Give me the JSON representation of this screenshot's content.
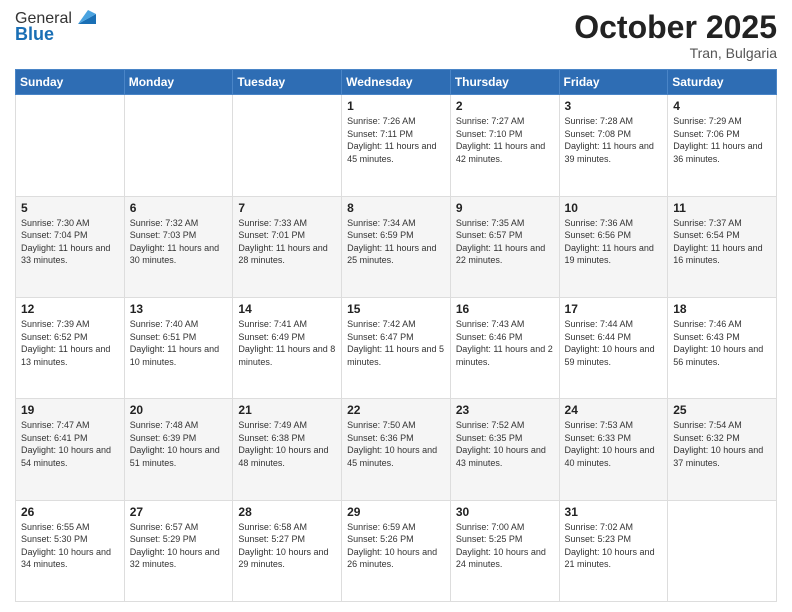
{
  "header": {
    "logo_general": "General",
    "logo_blue": "Blue",
    "month": "October 2025",
    "location": "Tran, Bulgaria"
  },
  "days_of_week": [
    "Sunday",
    "Monday",
    "Tuesday",
    "Wednesday",
    "Thursday",
    "Friday",
    "Saturday"
  ],
  "weeks": [
    [
      {
        "day": "",
        "info": ""
      },
      {
        "day": "",
        "info": ""
      },
      {
        "day": "",
        "info": ""
      },
      {
        "day": "1",
        "info": "Sunrise: 7:26 AM\nSunset: 7:11 PM\nDaylight: 11 hours and 45 minutes."
      },
      {
        "day": "2",
        "info": "Sunrise: 7:27 AM\nSunset: 7:10 PM\nDaylight: 11 hours and 42 minutes."
      },
      {
        "day": "3",
        "info": "Sunrise: 7:28 AM\nSunset: 7:08 PM\nDaylight: 11 hours and 39 minutes."
      },
      {
        "day": "4",
        "info": "Sunrise: 7:29 AM\nSunset: 7:06 PM\nDaylight: 11 hours and 36 minutes."
      }
    ],
    [
      {
        "day": "5",
        "info": "Sunrise: 7:30 AM\nSunset: 7:04 PM\nDaylight: 11 hours and 33 minutes."
      },
      {
        "day": "6",
        "info": "Sunrise: 7:32 AM\nSunset: 7:03 PM\nDaylight: 11 hours and 30 minutes."
      },
      {
        "day": "7",
        "info": "Sunrise: 7:33 AM\nSunset: 7:01 PM\nDaylight: 11 hours and 28 minutes."
      },
      {
        "day": "8",
        "info": "Sunrise: 7:34 AM\nSunset: 6:59 PM\nDaylight: 11 hours and 25 minutes."
      },
      {
        "day": "9",
        "info": "Sunrise: 7:35 AM\nSunset: 6:57 PM\nDaylight: 11 hours and 22 minutes."
      },
      {
        "day": "10",
        "info": "Sunrise: 7:36 AM\nSunset: 6:56 PM\nDaylight: 11 hours and 19 minutes."
      },
      {
        "day": "11",
        "info": "Sunrise: 7:37 AM\nSunset: 6:54 PM\nDaylight: 11 hours and 16 minutes."
      }
    ],
    [
      {
        "day": "12",
        "info": "Sunrise: 7:39 AM\nSunset: 6:52 PM\nDaylight: 11 hours and 13 minutes."
      },
      {
        "day": "13",
        "info": "Sunrise: 7:40 AM\nSunset: 6:51 PM\nDaylight: 11 hours and 10 minutes."
      },
      {
        "day": "14",
        "info": "Sunrise: 7:41 AM\nSunset: 6:49 PM\nDaylight: 11 hours and 8 minutes."
      },
      {
        "day": "15",
        "info": "Sunrise: 7:42 AM\nSunset: 6:47 PM\nDaylight: 11 hours and 5 minutes."
      },
      {
        "day": "16",
        "info": "Sunrise: 7:43 AM\nSunset: 6:46 PM\nDaylight: 11 hours and 2 minutes."
      },
      {
        "day": "17",
        "info": "Sunrise: 7:44 AM\nSunset: 6:44 PM\nDaylight: 10 hours and 59 minutes."
      },
      {
        "day": "18",
        "info": "Sunrise: 7:46 AM\nSunset: 6:43 PM\nDaylight: 10 hours and 56 minutes."
      }
    ],
    [
      {
        "day": "19",
        "info": "Sunrise: 7:47 AM\nSunset: 6:41 PM\nDaylight: 10 hours and 54 minutes."
      },
      {
        "day": "20",
        "info": "Sunrise: 7:48 AM\nSunset: 6:39 PM\nDaylight: 10 hours and 51 minutes."
      },
      {
        "day": "21",
        "info": "Sunrise: 7:49 AM\nSunset: 6:38 PM\nDaylight: 10 hours and 48 minutes."
      },
      {
        "day": "22",
        "info": "Sunrise: 7:50 AM\nSunset: 6:36 PM\nDaylight: 10 hours and 45 minutes."
      },
      {
        "day": "23",
        "info": "Sunrise: 7:52 AM\nSunset: 6:35 PM\nDaylight: 10 hours and 43 minutes."
      },
      {
        "day": "24",
        "info": "Sunrise: 7:53 AM\nSunset: 6:33 PM\nDaylight: 10 hours and 40 minutes."
      },
      {
        "day": "25",
        "info": "Sunrise: 7:54 AM\nSunset: 6:32 PM\nDaylight: 10 hours and 37 minutes."
      }
    ],
    [
      {
        "day": "26",
        "info": "Sunrise: 6:55 AM\nSunset: 5:30 PM\nDaylight: 10 hours and 34 minutes."
      },
      {
        "day": "27",
        "info": "Sunrise: 6:57 AM\nSunset: 5:29 PM\nDaylight: 10 hours and 32 minutes."
      },
      {
        "day": "28",
        "info": "Sunrise: 6:58 AM\nSunset: 5:27 PM\nDaylight: 10 hours and 29 minutes."
      },
      {
        "day": "29",
        "info": "Sunrise: 6:59 AM\nSunset: 5:26 PM\nDaylight: 10 hours and 26 minutes."
      },
      {
        "day": "30",
        "info": "Sunrise: 7:00 AM\nSunset: 5:25 PM\nDaylight: 10 hours and 24 minutes."
      },
      {
        "day": "31",
        "info": "Sunrise: 7:02 AM\nSunset: 5:23 PM\nDaylight: 10 hours and 21 minutes."
      },
      {
        "day": "",
        "info": ""
      }
    ]
  ]
}
